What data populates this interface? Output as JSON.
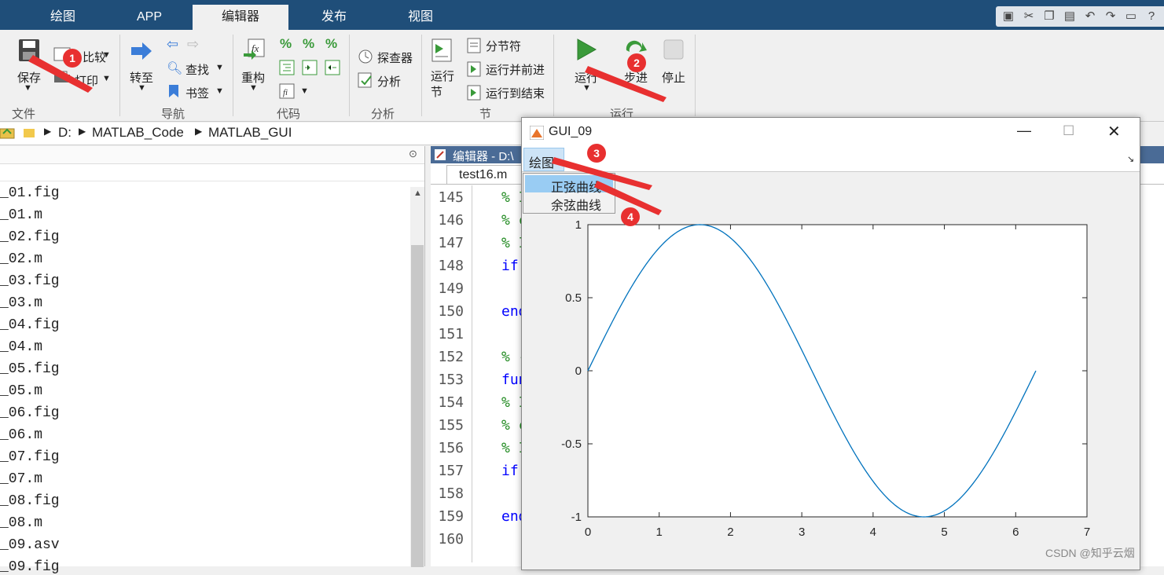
{
  "tabs": [
    {
      "label": "绘图"
    },
    {
      "label": "APP"
    },
    {
      "label": "编辑器"
    },
    {
      "label": "发布"
    },
    {
      "label": "视图"
    }
  ],
  "toolstrip": {
    "file": {
      "save": "保存",
      "compare": "比较",
      "print": "打印",
      "section": "文件"
    },
    "nav": {
      "goto": "转至",
      "find": "查找",
      "bookmark": "书签",
      "section": "导航"
    },
    "code": {
      "refactor": "重构",
      "section": "代码"
    },
    "analyze": {
      "profiler": "探查器",
      "analyze": "分析",
      "section": "分析"
    },
    "sectiongroup": {
      "run_section": "运行\n节",
      "section_break": "分节符",
      "run_advance": "运行并前进",
      "run_to_end": "运行到结束",
      "section": "节"
    },
    "run": {
      "run": "运行",
      "step": "步进",
      "stop": "停止",
      "section": "运行"
    }
  },
  "address": {
    "parts": [
      "D:",
      "MATLAB_Code",
      "MATLAB_GUI"
    ]
  },
  "files": [
    "_01.fig",
    "_01.m",
    "_02.fig",
    "_02.m",
    "_03.fig",
    "_03.m",
    "_04.fig",
    "_04.m",
    "_05.fig",
    "_05.m",
    "_06.fig",
    "_06.m",
    "_07.fig",
    "_07.m",
    "_08.fig",
    "_08.m",
    "_09.asv",
    "_09.fig"
  ],
  "editor": {
    "title": "编辑器 - D:\\",
    "tab": "test16.m",
    "lines": [
      {
        "n": "145",
        "t": "% I",
        "c": "#228b22"
      },
      {
        "n": "146",
        "t": "% c",
        "c": "#228b22"
      },
      {
        "n": "147",
        "t": "% I",
        "c": "#228b22"
      },
      {
        "n": "148",
        "t": "if",
        "c": "#0000ff"
      },
      {
        "n": "149",
        "t": "",
        "c": "#000"
      },
      {
        "n": "150",
        "t": "end",
        "c": "#0000ff"
      },
      {
        "n": "151",
        "t": "",
        "c": "#000"
      },
      {
        "n": "152",
        "t": "% -",
        "c": "#228b22"
      },
      {
        "n": "153",
        "t": "fun",
        "c": "#0000ff"
      },
      {
        "n": "154",
        "t": "% I",
        "c": "#228b22"
      },
      {
        "n": "155",
        "t": "% c",
        "c": "#228b22"
      },
      {
        "n": "156",
        "t": "% I",
        "c": "#228b22"
      },
      {
        "n": "157",
        "t": "if",
        "c": "#0000ff"
      },
      {
        "n": "158",
        "t": "",
        "c": "#000"
      },
      {
        "n": "159",
        "t": "end",
        "c": "#0000ff"
      },
      {
        "n": "160",
        "t": "",
        "c": "#000"
      }
    ]
  },
  "figure": {
    "title": "GUI_09",
    "menu": "绘图",
    "items": [
      "正弦曲线",
      "余弦曲线"
    ],
    "plot_color": "#0072bd"
  },
  "chart_data": {
    "type": "line",
    "title": "",
    "xlabel": "",
    "ylabel": "",
    "xlim": [
      0,
      7
    ],
    "ylim": [
      -1,
      1
    ],
    "xticks": [
      "0",
      "1",
      "2",
      "3",
      "4",
      "5",
      "6",
      "7"
    ],
    "yticks": [
      "1",
      "0.5",
      "0",
      "-0.5",
      "-1"
    ],
    "series": [
      {
        "function": "sin(x)",
        "x_range": [
          0,
          6.2832
        ]
      }
    ]
  },
  "markers": [
    "1",
    "2",
    "3",
    "4"
  ],
  "watermark": "CSDN @知乎云烟"
}
